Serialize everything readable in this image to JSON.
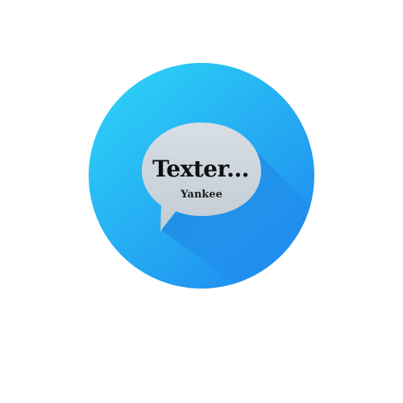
{
  "logo": {
    "title": "Texter...",
    "subtitle": "Yankee",
    "icon": "speech-bubble-icon",
    "colors": {
      "circle_light": "#2ccdf6",
      "circle_dark": "#1f8ef0",
      "bubble": "#cdd6dd",
      "text": "#0f0f10"
    }
  }
}
